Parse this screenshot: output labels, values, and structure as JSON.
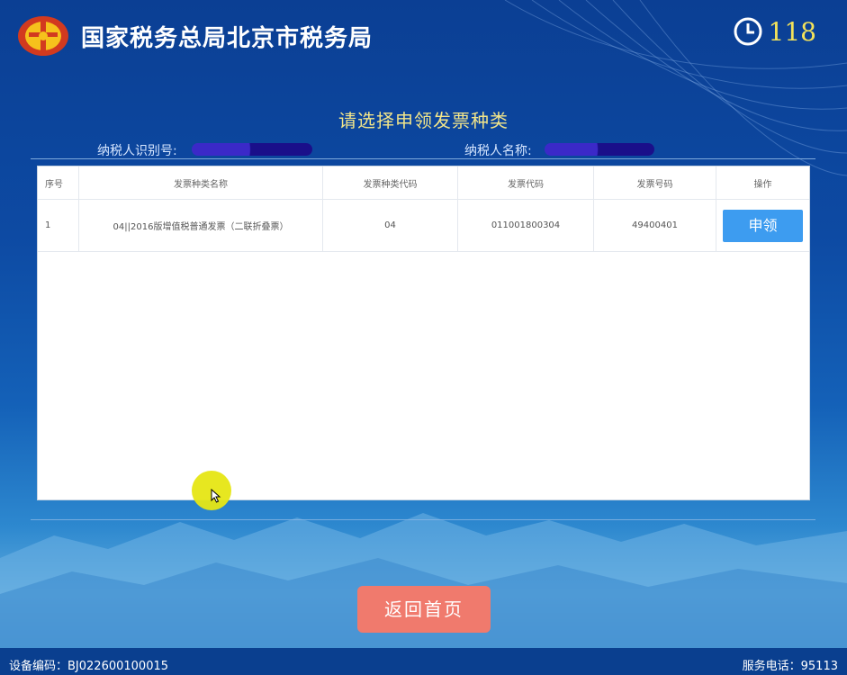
{
  "header": {
    "agency_name": "国家税务总局北京市税务局",
    "countdown": "118",
    "emblem_icon": "tax-emblem-icon",
    "clock_icon": "clock-icon"
  },
  "page": {
    "heading": "请选择申领发票种类",
    "taxpayer_id_label": "纳税人识别号:",
    "taxpayer_name_label": "纳税人名称:"
  },
  "table": {
    "columns": [
      "序号",
      "发票种类名称",
      "发票种类代码",
      "发票代码",
      "发票号码",
      "操作"
    ],
    "rows": [
      {
        "seq": "1",
        "name": "04||2016版增值税普通发票（二联折叠票）",
        "type_code": "04",
        "invoice_code": "011001800304",
        "invoice_number": "49400401",
        "action_label": "申领"
      }
    ]
  },
  "actions": {
    "home_label": "返回首页"
  },
  "footer": {
    "device_label": "设备编码：",
    "device_code": "BJ022600100015",
    "service_label": "服务电话：",
    "service_phone": "95113"
  },
  "colors": {
    "accent_blue": "#3d9cf0",
    "home_button": "#f07a6d",
    "heading_gold": "#f2e58a",
    "timer_yellow": "#f3e25a"
  }
}
